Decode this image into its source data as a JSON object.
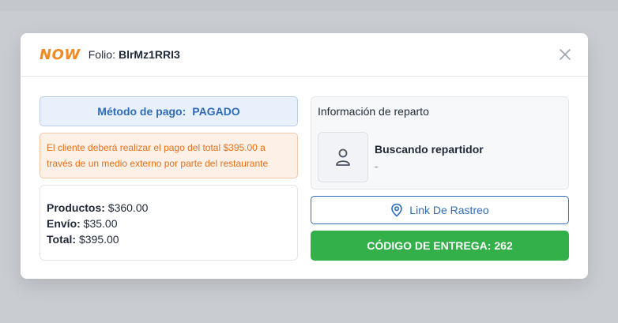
{
  "header": {
    "logo_text": "NOW",
    "folio_label": "Folio:",
    "folio_value": "BlrMz1RRI3",
    "close_icon": "close-icon"
  },
  "payment": {
    "label": "Método de pago:",
    "value": "PAGADO"
  },
  "warning": {
    "text": "El cliente deberá realizar el pago del total $395.00 a través de un medio externo por parte del restaurante"
  },
  "totals": {
    "products_label": "Productos:",
    "products_value": "$360.00",
    "shipping_label": "Envío:",
    "shipping_value": "$35.00",
    "total_label": "Total:",
    "total_value": "$395.00"
  },
  "delivery": {
    "title": "Información de reparto",
    "courier_name": "Buscando repartidor",
    "courier_sub": "-",
    "avatar_icon": "user-icon"
  },
  "tracking": {
    "label": "Link De Rastreo",
    "icon": "location-pin-icon"
  },
  "delivery_code": {
    "label": "CÓDIGO DE ENTREGA:",
    "value": "262"
  },
  "colors": {
    "accent_blue": "#2e6cb8",
    "success_green": "#33b04a",
    "warning_orange": "#e8711c",
    "logo_orange": "#f08a24"
  }
}
